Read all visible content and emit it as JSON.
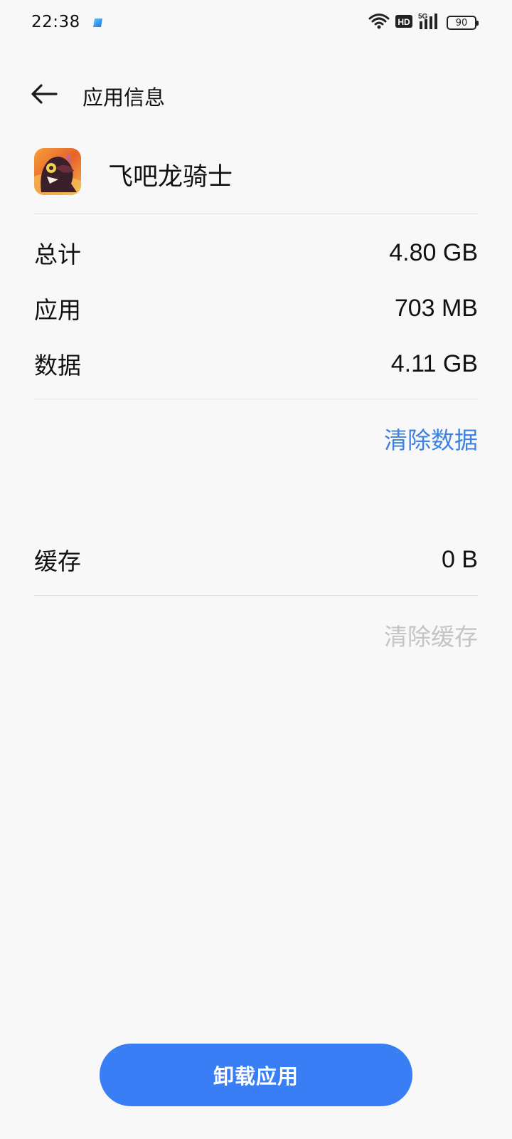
{
  "status_bar": {
    "time": "22:38",
    "battery": "90",
    "network": "5G",
    "hd_badge": "HD",
    "icons": [
      "wifi-icon",
      "hd-icon",
      "signal-5g-icon",
      "battery-icon"
    ]
  },
  "header": {
    "back_icon": "arrow-left-icon",
    "title": "应用信息"
  },
  "app": {
    "name": "飞吧龙骑士",
    "icon": "game-dragon-knight-icon"
  },
  "storage": {
    "rows": [
      {
        "label": "总计",
        "value": "4.80 GB"
      },
      {
        "label": "应用",
        "value": "703 MB"
      },
      {
        "label": "数据",
        "value": "4.11 GB"
      }
    ],
    "clear_data_label": "清除数据",
    "cache_label": "缓存",
    "cache_value": "0 B",
    "clear_cache_label": "清除缓存"
  },
  "actions": {
    "uninstall_label": "卸载应用"
  },
  "colors": {
    "accent": "#3a7ef5",
    "link": "#3d82e0",
    "disabled": "#c4c4c4",
    "background": "#f8f8f8"
  }
}
